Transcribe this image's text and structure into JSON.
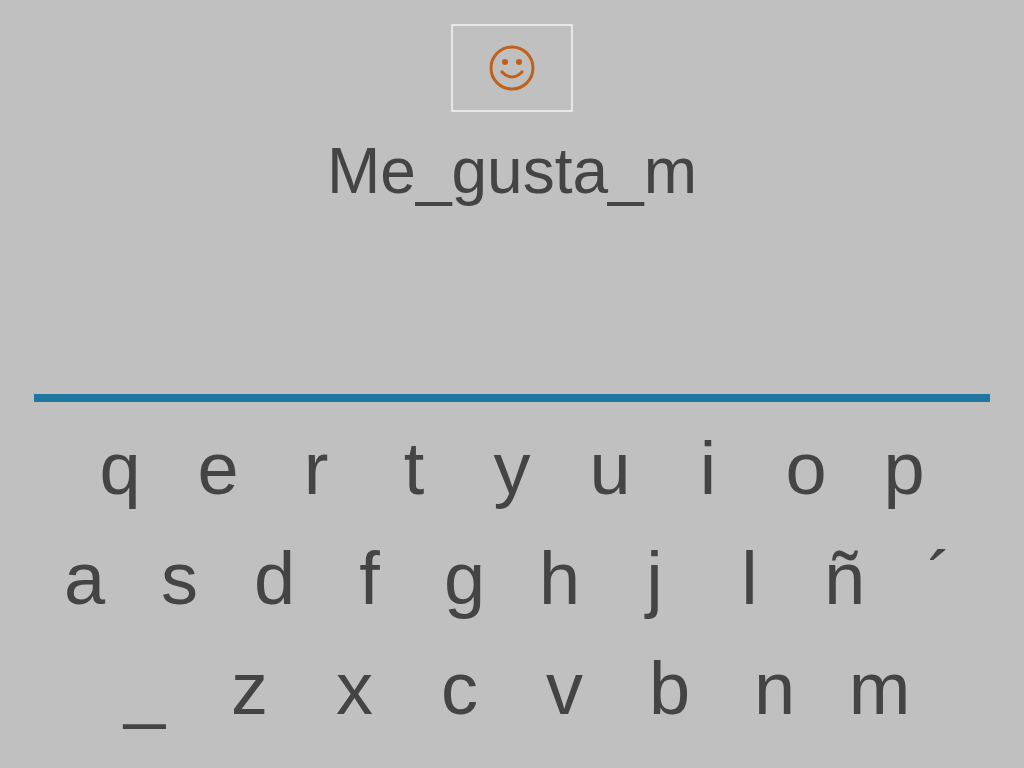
{
  "answer": {
    "text": "Me_gusta_m"
  },
  "keyboard": {
    "rows": [
      [
        "q",
        "e",
        "r",
        "t",
        "y",
        "u",
        "i",
        "o",
        "p"
      ],
      [
        "a",
        "s",
        "d",
        "f",
        "g",
        "h",
        "j",
        "l",
        "ñ",
        "´"
      ],
      [
        "_",
        "z",
        "x",
        "c",
        "v",
        "b",
        "n",
        "m"
      ]
    ]
  }
}
